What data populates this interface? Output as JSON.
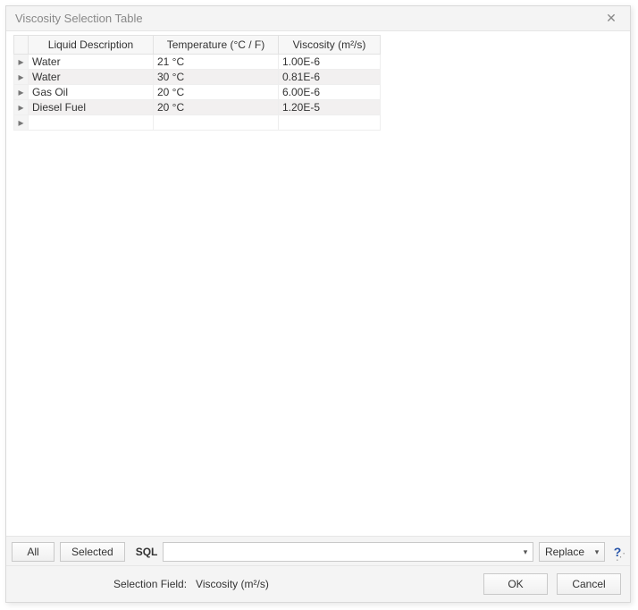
{
  "title": "Viscosity Selection Table",
  "columns": [
    "Liquid Description",
    "Temperature (°C / F)",
    "Viscosity (m²/s)"
  ],
  "rows": [
    {
      "desc": "Water",
      "temp": "21 °C",
      "visc": "1.00E-6"
    },
    {
      "desc": "Water",
      "temp": "30 °C",
      "visc": "0.81E-6"
    },
    {
      "desc": "Gas Oil",
      "temp": "20 °C",
      "visc": "6.00E-6"
    },
    {
      "desc": "Diesel Fuel",
      "temp": "20 °C",
      "visc": "1.20E-5"
    }
  ],
  "bottom": {
    "all_label": "All",
    "selected_label": "Selected",
    "sql_label": "SQL",
    "sql_value": "",
    "replace_label": "Replace",
    "help_label": "?"
  },
  "footer": {
    "selection_field_label": "Selection Field:",
    "selection_field_value": "Viscosity (m²/s)",
    "ok_label": "OK",
    "cancel_label": "Cancel"
  }
}
